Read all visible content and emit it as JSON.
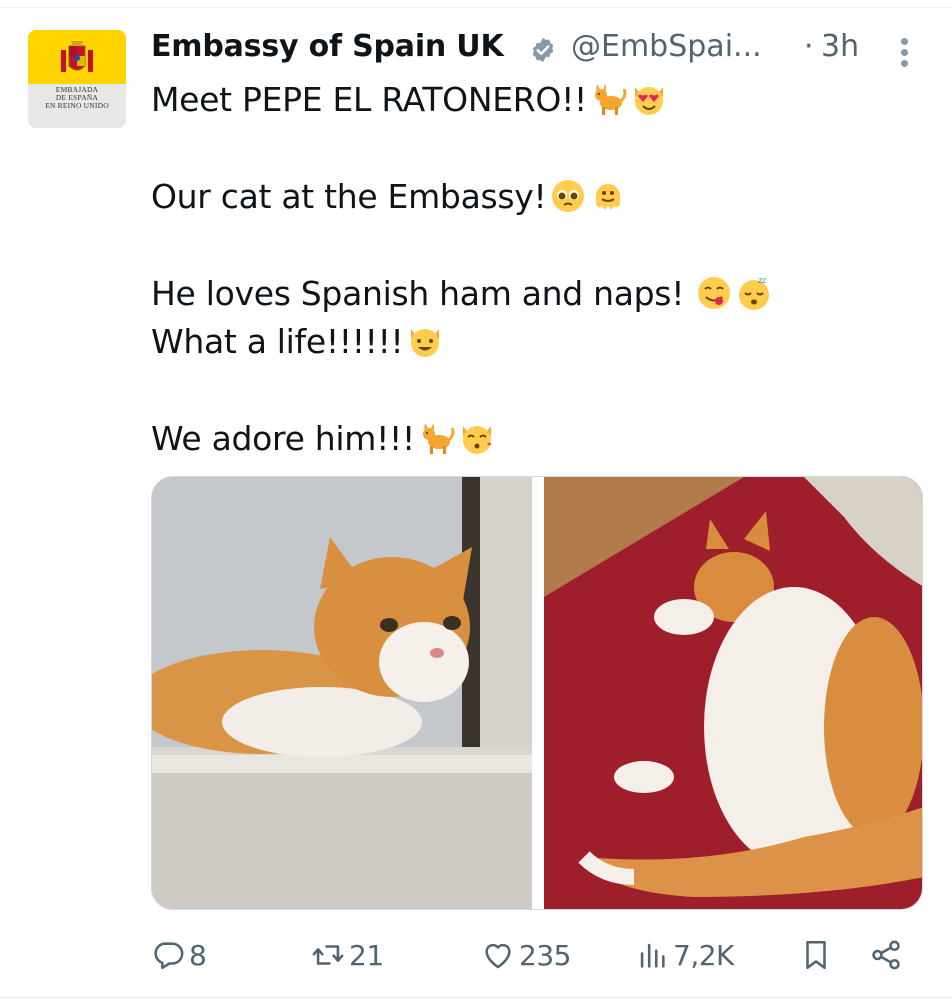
{
  "author": {
    "name": "Embassy of Spain UK",
    "handle": "@EmbSpai...",
    "separator": "·",
    "time": "3h",
    "avatar_lines": [
      "EMBAJADA",
      "DE ESPAÑA",
      "EN REINO UNIDO"
    ]
  },
  "tweet": {
    "lines": [
      "Meet PEPE EL RATONERO!!",
      "",
      "Our cat at the Embassy!",
      "",
      "He loves Spanish ham and naps!",
      "What a life!!!!!!",
      "",
      "We adore him!!!"
    ]
  },
  "icons": {
    "verified": "verified-badge-icon",
    "more": "more-options-icon",
    "reply": "reply-icon",
    "retweet": "retweet-icon",
    "like": "heart-icon",
    "views": "views-chart-icon",
    "bookmark": "bookmark-icon",
    "share": "share-icon"
  },
  "actions": {
    "replies": "8",
    "reposts": "21",
    "likes": "235",
    "views": "7,2K"
  },
  "colors": {
    "text": "#0f1419",
    "secondary": "#536471",
    "verified_gray": "#829aab",
    "avatar_yellow": "#ffd400"
  }
}
